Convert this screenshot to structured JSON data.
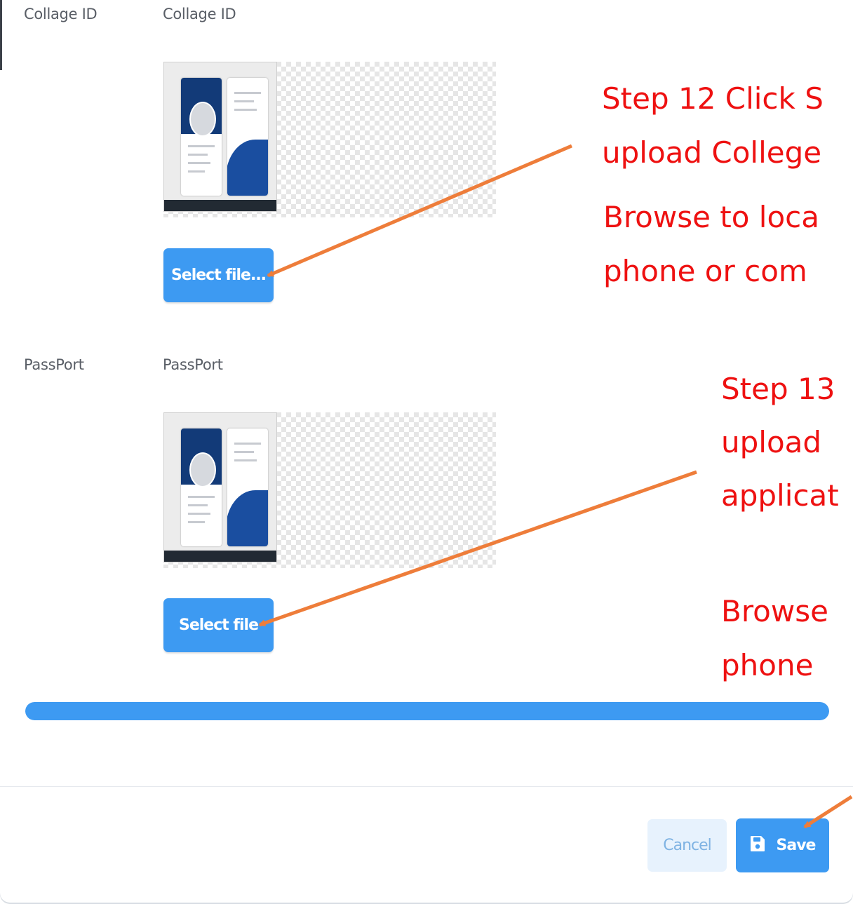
{
  "form": {
    "collage_row_label": "Collage ID",
    "collage_field_label": "Collage ID",
    "collage_button": "Select file...",
    "passport_row_label": "PassPort",
    "passport_field_label": "PassPort",
    "passport_button": "Select file"
  },
  "upload_progress": {
    "percent": 100
  },
  "footer": {
    "cancel_label": "Cancel",
    "save_label": "Save"
  },
  "annotations": {
    "step12_line1": "Step 12 Click S",
    "step12_line2": "upload College",
    "step12_line3": "Browse to loca",
    "step12_line4": "phone or com",
    "step13_line1": "Step 13",
    "step13_line2": "upload",
    "step13_line3": "applicat",
    "step13_line4": "Browse",
    "step13_line5": "phone"
  },
  "colors": {
    "accent": "#3d9af2",
    "annotation_text": "#ee1111",
    "arrow": "#ee7d3a"
  }
}
